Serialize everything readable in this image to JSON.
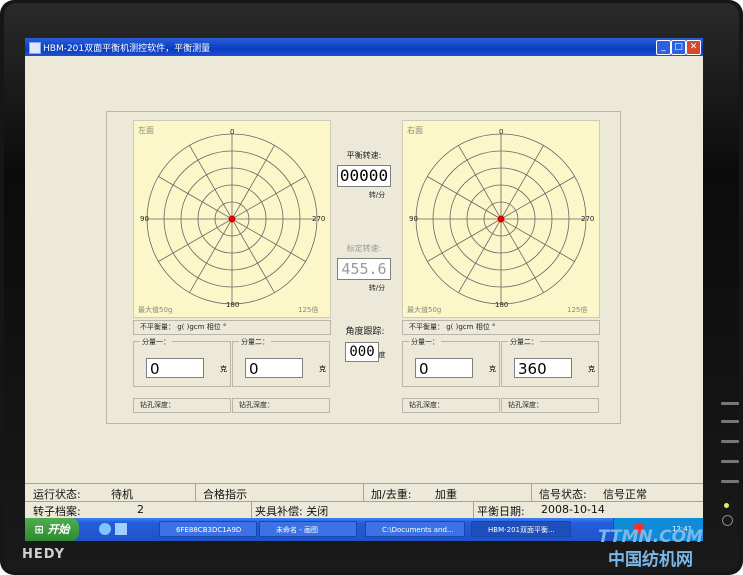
{
  "window": {
    "title": "HBM-201双面平衡机测控软件，平衡测量",
    "min": "_",
    "max": "□",
    "close": "✕"
  },
  "left_plot": {
    "label": "左面",
    "a0": "0",
    "a90": "90",
    "a180": "180",
    "a270": "270",
    "maxval": "最大值50g",
    "scale": "125倍"
  },
  "right_plot": {
    "label": "右面",
    "a0": "0",
    "a90": "90",
    "a180": "180",
    "a270": "270",
    "maxval": "最大值50g",
    "scale": "125倍"
  },
  "center": {
    "speed_label": "平衡转速:",
    "speed_value": "00000",
    "speed_unit": "转/分",
    "calib_label": "标定转速:",
    "calib_value": "455.6",
    "calib_unit": "转/分",
    "angle_label": "角度跟踪:",
    "angle_value": "000",
    "angle_unit": "度"
  },
  "left_info": {
    "text": "不平衡量：   g(    )gcm  相位    °"
  },
  "right_info": {
    "text": "不平衡量：   g(    )gcm  相位    °"
  },
  "left_comp1": {
    "caption": "分量一：",
    "value": "0",
    "unit": "克"
  },
  "left_comp2": {
    "caption": "分量二：",
    "value": "0",
    "unit": "克"
  },
  "right_comp1": {
    "caption": "分量一：",
    "value": "0",
    "unit": "克"
  },
  "right_comp2": {
    "caption": "分量二：",
    "value": "360",
    "unit": "克"
  },
  "drill": {
    "l1": "钻孔深度：",
    "l2": "钻孔深度：",
    "r1": "钻孔深度：",
    "r2": "钻孔深度："
  },
  "status1": {
    "run_label": "运行状态:",
    "run_value": "待机",
    "pass": "合格指示",
    "addsub_label": "加/去重:",
    "addsub_value": "加重",
    "signal_label": "信号状态:",
    "signal_value": "信号正常"
  },
  "status2": {
    "rotor_label": "转子档案:",
    "rotor_value": "2",
    "fixture": "夹具补偿: 关闭",
    "date_label": "平衡日期:",
    "date_value": "2008-10-14"
  },
  "taskbar": {
    "start": "开始",
    "items": [
      "6FE88CB3DC1A9D",
      "未命名 - 画图",
      "C:\\Documents and...",
      "HBM-201双面平衡..."
    ],
    "time": "12:41"
  },
  "bezel": {
    "brand": "HEDY",
    "wm1": "TTMN.COM",
    "wm2": "中国纺机网"
  },
  "colors": {
    "accent_red": "#e00000",
    "plot_bg": "#fbf7c9",
    "xp_blue": "#245edb"
  }
}
